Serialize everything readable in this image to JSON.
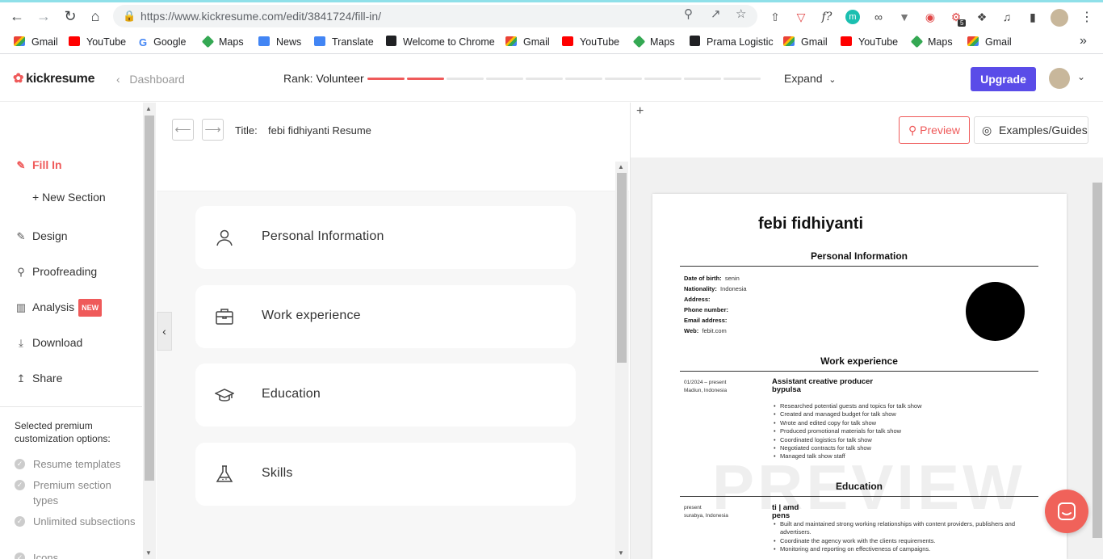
{
  "browser": {
    "url": "https://www.kickresume.com/edit/3841724/fill-in/",
    "ext_badge": "5",
    "bookmarks": [
      "Gmail",
      "YouTube",
      "Google",
      "Maps",
      "News",
      "Translate",
      "Welcome to Chrome",
      "Gmail",
      "YouTube",
      "Maps",
      "Prama Logistic",
      "Gmail",
      "YouTube",
      "Maps",
      "Gmail"
    ]
  },
  "header": {
    "logo": "kickresume",
    "dashboard": "Dashboard",
    "rank_label": "Rank:",
    "rank_value": "Volunteer",
    "rank_progress": {
      "filled": 2,
      "total": 10
    },
    "expand": "Expand",
    "upgrade": "Upgrade"
  },
  "sidebar": {
    "items": [
      {
        "label": "Fill In",
        "icon": "edit-icon"
      },
      {
        "label": "+ New Section",
        "icon": ""
      },
      {
        "label": "Design",
        "icon": "design-icon"
      },
      {
        "label": "Proofreading",
        "icon": "proofreading-icon"
      },
      {
        "label": "Analysis",
        "icon": "chart-icon",
        "badge": "NEW"
      },
      {
        "label": "Download",
        "icon": "download-icon"
      },
      {
        "label": "Share",
        "icon": "share-icon"
      }
    ],
    "premium_title": "Selected premium customization options:",
    "premium_items": [
      "Resume templates",
      "Premium section types",
      "Unlimited subsections",
      "Icons"
    ]
  },
  "editor": {
    "title_label": "Title:",
    "title_value": "febi fidhiyanti Resume",
    "sections": [
      {
        "label": "Personal Information",
        "icon": "person-icon"
      },
      {
        "label": "Work experience",
        "icon": "briefcase-icon"
      },
      {
        "label": "Education",
        "icon": "graduation-cap-icon"
      },
      {
        "label": "Skills",
        "icon": "flask-icon"
      }
    ]
  },
  "preview_panel": {
    "preview_btn": "Preview",
    "examples_btn": "Examples/Guides",
    "watermark": "PREVIEW"
  },
  "resume": {
    "name": "febi fidhiyanti",
    "personal_title": "Personal Information",
    "personal": [
      {
        "k": "Date of birth:",
        "v": "senin"
      },
      {
        "k": "Nationality:",
        "v": "Indonesia"
      },
      {
        "k": "Address:",
        "v": ""
      },
      {
        "k": "Phone number:",
        "v": ""
      },
      {
        "k": "Email address:",
        "v": ""
      },
      {
        "k": "Web:",
        "v": "febit.com"
      }
    ],
    "work_title": "Work experience",
    "work": {
      "date": "01/2024 – present",
      "place": "Madiun, Indonesia",
      "role": "Assistant creative producer",
      "company": "bypulsa",
      "bullets": [
        "Researched potential guests and topics for talk show",
        "Created and managed budget for talk show",
        "Wrote and edited copy for talk show",
        "Produced promotional materials for talk show",
        "Coordinated logistics for talk show",
        "Negotiated contracts for talk show",
        "Managed talk show staff"
      ]
    },
    "edu_title": "Education",
    "edu": {
      "date": "present",
      "place": "surabya, Indonesia",
      "role": "ti | amd",
      "school": "pens",
      "bullets": [
        "Built and maintained strong working relationships with content providers, publishers and advertisers.",
        "Coordinate the agency work with the clients requirements.",
        "Monitoring and reporting on effectiveness of campaigns."
      ]
    }
  },
  "colors": {
    "accent": "#ef5a5a",
    "upgrade": "#5a4ce8",
    "chat": "#f0625a"
  }
}
